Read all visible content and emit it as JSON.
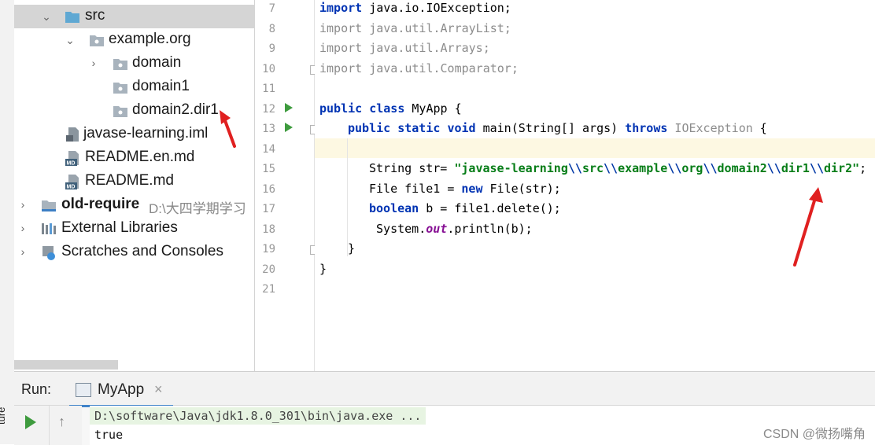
{
  "left_strip": {
    "vertical_text": "ture"
  },
  "tree": {
    "items": [
      {
        "label": "src",
        "type": "folder-src",
        "expanded": true
      },
      {
        "label": "example.org",
        "type": "package",
        "expanded": true
      },
      {
        "label": "domain",
        "type": "package",
        "expanded": false
      },
      {
        "label": "domain1",
        "type": "package"
      },
      {
        "label": "domain2.dir1",
        "type": "package"
      },
      {
        "label": "javase-learning.iml",
        "type": "iml-file"
      },
      {
        "label": "README.en.md",
        "type": "md-file"
      },
      {
        "label": "README.md",
        "type": "md-file"
      },
      {
        "label": "old-require",
        "path": "D:\\大四学期学习",
        "type": "module"
      },
      {
        "label": "External Libraries",
        "type": "libraries"
      },
      {
        "label": "Scratches and Consoles",
        "type": "scratches"
      }
    ]
  },
  "editor": {
    "line_numbers": [
      "7",
      "8",
      "9",
      "10",
      "11",
      "12",
      "13",
      "14",
      "15",
      "16",
      "17",
      "18",
      "19",
      "20",
      "21"
    ],
    "lines": {
      "l7": {
        "kw": "import",
        "rest": " java.io.IOException;"
      },
      "l8": {
        "kw": "import",
        "rest": " java.util.ArrayList;"
      },
      "l9": {
        "kw": "import",
        "rest": " java.util.Arrays;"
      },
      "l10": {
        "kw": "import",
        "rest": " java.util.Comparator;"
      },
      "l12": {
        "kw1": "public",
        "kw2": "class",
        "rest": " MyApp {"
      },
      "l13": {
        "kw1": "public",
        "kw2": "static",
        "kw3": "void",
        "mid": " main(String[] args) ",
        "kw4": "throws",
        "exc": " IOException",
        "tail": " {"
      },
      "l15": {
        "pre": "String str= ",
        "q1": "\"javase-learning",
        "e1": "\\\\",
        "s2": "src",
        "e2": "\\\\",
        "s3": "example",
        "e3": "\\\\",
        "s4": "org",
        "e4": "\\\\",
        "s5": "domain2",
        "e5": "\\\\",
        "s6": "dir1",
        "e6": "\\\\",
        "s7": "dir2\"",
        "tail": ";"
      },
      "l16": {
        "pre": "File file1 = ",
        "kw": "new",
        "rest": " File(str);"
      },
      "l17": {
        "kw": "boolean",
        "rest": " b = file1.delete();"
      },
      "l18": {
        "pre": " System.",
        "it": "out",
        "rest": ".println(b);"
      },
      "l19": {
        "text": "}"
      },
      "l20": {
        "text": "}"
      }
    }
  },
  "run_panel": {
    "label": "Run:",
    "tab_label": "MyApp",
    "tab_close": "×",
    "up_icon": "↑",
    "console_line1": "D:\\software\\Java\\jdk1.8.0_301\\bin\\java.exe ...",
    "console_line2": "true"
  },
  "watermark": "CSDN @微扬嘴角",
  "colors": {
    "keyword": "#0033b3",
    "string": "#067d17",
    "run_green": "#3e9b3e",
    "arrow_red": "#e02020",
    "selection": "#d5d5d5"
  }
}
